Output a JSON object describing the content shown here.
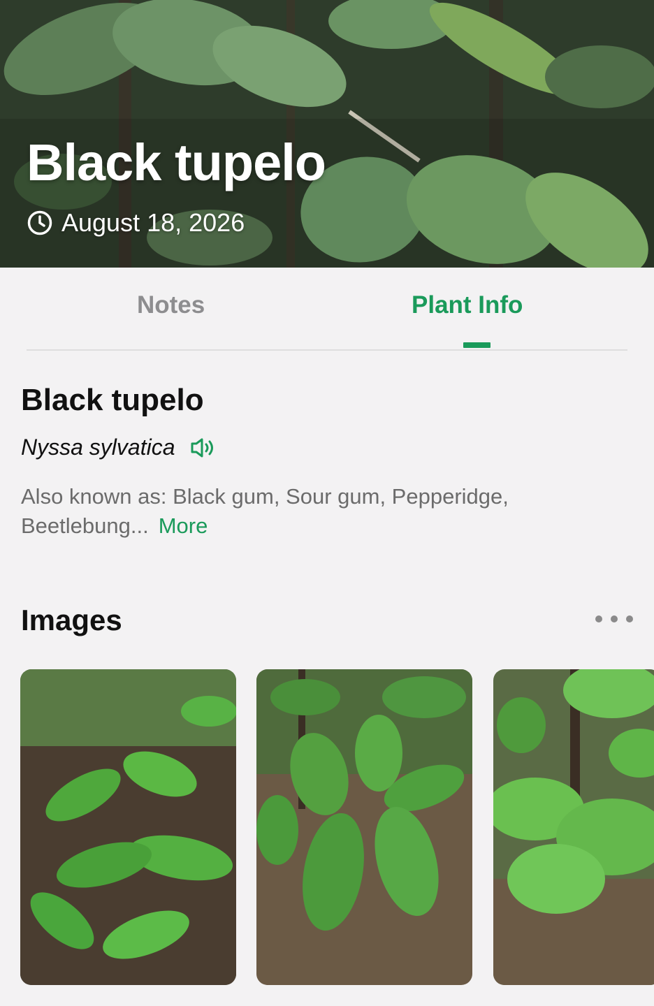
{
  "hero": {
    "title": "Black tupelo",
    "date": "August 18, 2026"
  },
  "tabs": [
    {
      "label": "Notes",
      "active": false
    },
    {
      "label": "Plant Info",
      "active": true
    }
  ],
  "plant": {
    "common_name": "Black tupelo",
    "scientific_name": "Nyssa sylvatica",
    "aka_text": "Also known as: Black gum, Sour gum, Pepperidge, Beetlebung...",
    "more_label": "More"
  },
  "images": {
    "title": "Images",
    "thumbnails": [
      "leaf-photo-1",
      "leaf-photo-2",
      "leaf-photo-3"
    ]
  },
  "colors": {
    "accent": "#1a9a5a",
    "inactive_tab": "#8d8d8f",
    "background": "#f3f2f3"
  }
}
